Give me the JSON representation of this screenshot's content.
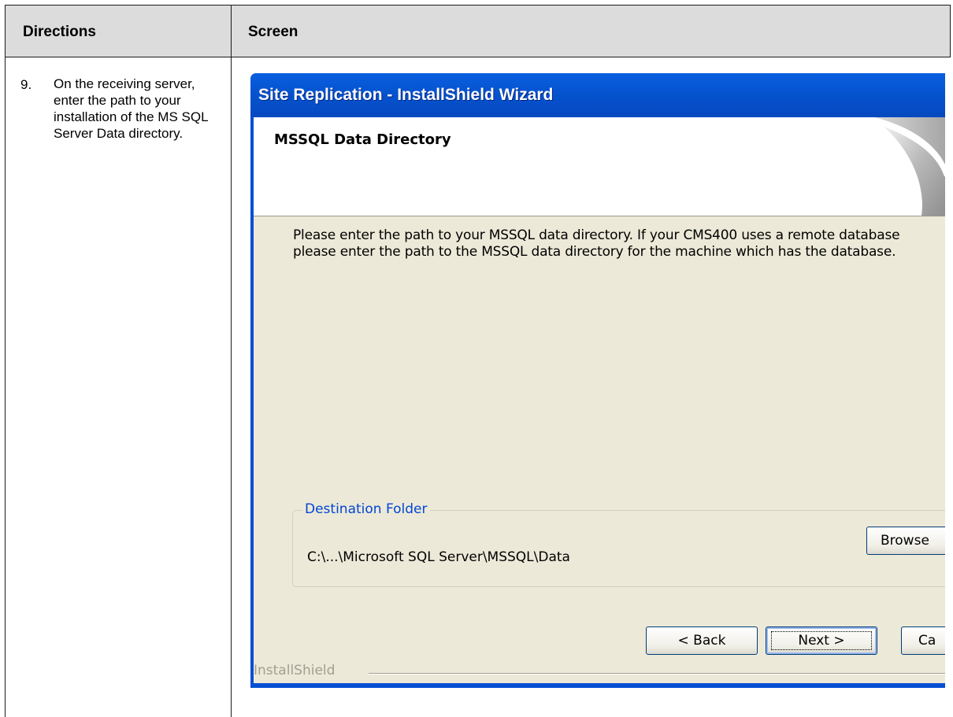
{
  "table": {
    "header_directions": "Directions",
    "header_screen": "Screen"
  },
  "step": {
    "number": "9.",
    "text": "On the receiving server, enter the path to your installation of the MS SQL Server Data directory."
  },
  "wizard": {
    "title": "Site Replication - InstallShield Wizard",
    "banner_title": "MSSQL Data Directory",
    "description": "Please enter the path to your MSSQL data directory.  If your CMS400 uses a remote database please enter the path to the MSSQL data directory for the machine which has the database.",
    "group_label": "Destination Folder",
    "folder_path": "C:\\...\\Microsoft SQL Server\\MSSQL\\Data",
    "browse_label": "Browse",
    "installshield_label": "InstallShield",
    "back_label": "< Back",
    "next_label": "Next >",
    "cancel_label": "Ca"
  },
  "colors": {
    "titlebar": "#0552cd",
    "dialog_face": "#ece9d8",
    "group_label": "#0046d5",
    "table_header": "#dcdcdc"
  }
}
